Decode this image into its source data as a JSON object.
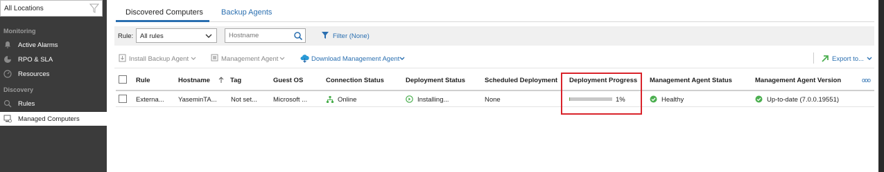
{
  "sidebar": {
    "location": "All Locations",
    "sections": [
      {
        "label": "Monitoring"
      },
      {
        "label": "Discovery"
      }
    ],
    "items": [
      {
        "label": "Active Alarms",
        "icon": "bell-icon"
      },
      {
        "label": "RPO & SLA",
        "icon": "pie-chart-icon"
      },
      {
        "label": "Resources",
        "icon": "gauge-icon"
      },
      {
        "label": "Rules",
        "icon": "rules-icon"
      },
      {
        "label": "Managed Computers",
        "icon": "computer-icon",
        "active": true
      }
    ]
  },
  "tabs": [
    {
      "label": "Discovered Computers",
      "active": true
    },
    {
      "label": "Backup Agents",
      "active": false
    }
  ],
  "filter_bar": {
    "rule_label": "Rule:",
    "rule_value": "All rules",
    "hostname_placeholder": "Hostname",
    "filter_label": "Filter (None)"
  },
  "toolbar": {
    "install_backup_agent": "Install Backup Agent",
    "management_agent": "Management Agent",
    "download_management_agent": "Download Management Agent",
    "export": "Export to..."
  },
  "table": {
    "columns": [
      "Rule",
      "Hostname",
      "Tag",
      "Guest OS",
      "Connection Status",
      "Deployment Status",
      "Scheduled Deployment",
      "Deployment Progress",
      "Management Agent Status",
      "Management Agent Version"
    ],
    "rows": [
      {
        "rule": "Externa...",
        "hostname": "YaseminTA...",
        "tag": "Not set...",
        "guest_os": "Microsoft ...",
        "connection_status": "Online",
        "deployment_status": "Installing...",
        "scheduled_deployment": "None",
        "deployment_progress_label": "1%",
        "deployment_progress_fraction": 0.01,
        "management_agent_status": "Healthy",
        "management_agent_version": "Up-to-date (7.0.0.19551)"
      }
    ]
  },
  "colors": {
    "accent": "#2a6fb0",
    "sidebar_bg": "#3b3b3b",
    "success": "#4caf50",
    "highlight": "#d9232a"
  }
}
